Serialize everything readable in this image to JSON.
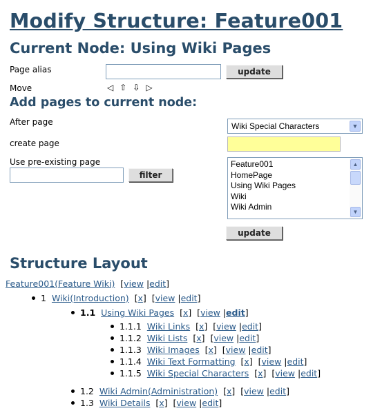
{
  "page_title": "Modify Structure: Feature001",
  "current_node": {
    "heading": "Current Node: Using Wiki Pages"
  },
  "page_alias": {
    "label": "Page alias",
    "value": "",
    "button": "update"
  },
  "move": {
    "label": "Move",
    "left": "◁",
    "up": "⇧",
    "down": "⇩",
    "right": "▷"
  },
  "add_pages": {
    "heading": "Add pages to current node:",
    "after_page_label": "After page",
    "after_page_value": "Wiki Special Characters",
    "create_page_label": "create page",
    "create_page_value": "",
    "pre_existing_label": "Use pre-existing page",
    "filter_value": "",
    "filter_button": "filter",
    "list_items": [
      "Feature001",
      "HomePage",
      "Using Wiki Pages",
      "Wiki",
      "Wiki Admin"
    ],
    "update_button": "update"
  },
  "layout": {
    "heading": "Structure Layout",
    "root": {
      "label": "Feature001(Feature Wiki)",
      "view": "view",
      "edit": "edit"
    },
    "nodes": [
      {
        "num": "1",
        "label": "Wiki(Introduction)"
      },
      {
        "num": "1.1",
        "label": "Using Wiki Pages"
      },
      {
        "num": "1.1.1",
        "label": "Wiki Links"
      },
      {
        "num": "1.1.2",
        "label": "Wiki Lists"
      },
      {
        "num": "1.1.3",
        "label": "Wiki Images"
      },
      {
        "num": "1.1.4",
        "label": "Wiki Text Formatting"
      },
      {
        "num": "1.1.5",
        "label": "Wiki Special Characters"
      },
      {
        "num": "1.2",
        "label": "Wiki Admin(Administration)"
      },
      {
        "num": "1.3",
        "label": "Wiki Details"
      }
    ],
    "x_label": "x",
    "view_label": "view",
    "edit_label": "edit"
  }
}
